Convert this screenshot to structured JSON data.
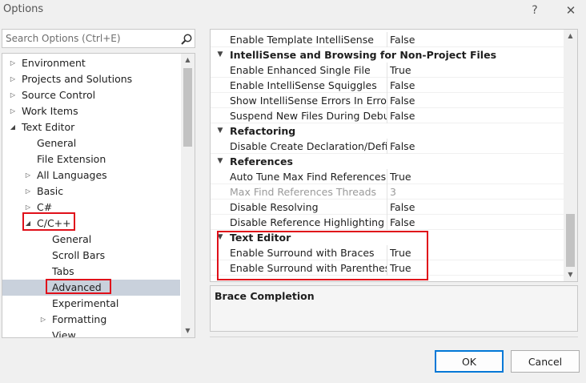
{
  "window": {
    "title": "Options",
    "help_label": "?",
    "close_label": "✕"
  },
  "search": {
    "placeholder": "Search Options (Ctrl+E)"
  },
  "tree": {
    "items": [
      {
        "label": "Environment",
        "level": 0,
        "arrow": "▷"
      },
      {
        "label": "Projects and Solutions",
        "level": 0,
        "arrow": "▷"
      },
      {
        "label": "Source Control",
        "level": 0,
        "arrow": "▷"
      },
      {
        "label": "Work Items",
        "level": 0,
        "arrow": "▷"
      },
      {
        "label": "Text Editor",
        "level": 0,
        "arrow": "◢"
      },
      {
        "label": "General",
        "level": 1,
        "arrow": ""
      },
      {
        "label": "File Extension",
        "level": 1,
        "arrow": ""
      },
      {
        "label": "All Languages",
        "level": 1,
        "arrow": "▷"
      },
      {
        "label": "Basic",
        "level": 1,
        "arrow": "▷"
      },
      {
        "label": "C#",
        "level": 1,
        "arrow": "▷"
      },
      {
        "label": "C/C++",
        "level": 1,
        "arrow": "◢"
      },
      {
        "label": "General",
        "level": 2,
        "arrow": ""
      },
      {
        "label": "Scroll Bars",
        "level": 2,
        "arrow": ""
      },
      {
        "label": "Tabs",
        "level": 2,
        "arrow": ""
      },
      {
        "label": "Advanced",
        "level": 2,
        "arrow": "",
        "selected": true
      },
      {
        "label": "Experimental",
        "level": 2,
        "arrow": ""
      },
      {
        "label": "Formatting",
        "level": 2,
        "arrow": "▷"
      },
      {
        "label": "View",
        "level": 2,
        "arrow": ""
      }
    ]
  },
  "grid": {
    "rows": [
      {
        "type": "prop",
        "name": "Enable Template IntelliSense",
        "value": "False"
      },
      {
        "type": "cat",
        "name": "IntelliSense and Browsing for Non-Project Files"
      },
      {
        "type": "prop",
        "name": "Enable Enhanced Single File",
        "value": "True"
      },
      {
        "type": "prop",
        "name": "Enable IntelliSense Squiggles",
        "value": "False"
      },
      {
        "type": "prop",
        "name": "Show IntelliSense Errors In Error List",
        "value": "False"
      },
      {
        "type": "prop",
        "name": "Suspend New Files During Debug",
        "value": "False"
      },
      {
        "type": "cat",
        "name": "Refactoring"
      },
      {
        "type": "prop",
        "name": "Disable Create Declaration/Definition",
        "value": "False"
      },
      {
        "type": "cat",
        "name": "References"
      },
      {
        "type": "prop",
        "name": "Auto Tune Max Find References Threads",
        "value": "True"
      },
      {
        "type": "prop",
        "name": "Max Find References Threads",
        "value": "3",
        "disabled": true
      },
      {
        "type": "prop",
        "name": "Disable Resolving",
        "value": "False"
      },
      {
        "type": "prop",
        "name": "Disable Reference Highlighting",
        "value": "False"
      },
      {
        "type": "cat",
        "name": "Text Editor"
      },
      {
        "type": "prop",
        "name": "Enable Surround with Braces",
        "value": "True"
      },
      {
        "type": "prop",
        "name": "Enable Surround with Parentheses",
        "value": "True"
      }
    ]
  },
  "description": {
    "title": "Brace Completion"
  },
  "buttons": {
    "ok": "OK",
    "cancel": "Cancel"
  },
  "colors": {
    "highlight": "#e0101a",
    "selection": "#c9d1dc",
    "accent": "#0078d7"
  }
}
